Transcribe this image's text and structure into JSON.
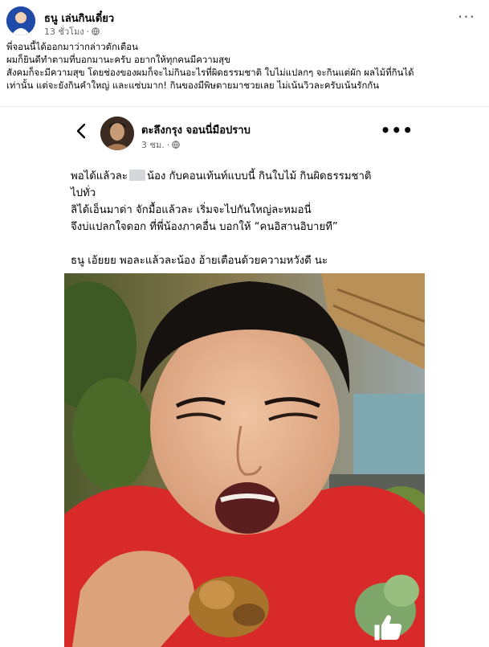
{
  "outer_post": {
    "author": "ธนู เล่นกินเดี๋ยว",
    "time": "13 ชั่วโมง",
    "more_icon": "more-options-icon",
    "caption_lines": [
      "พี่จอนนี้ได้ออกมาว่ากล่าวตักเตือน",
      "ผมก็ยินดีทำตามที่บอกมานะครับ อยากให้ทุกคนมีความสุข",
      "สังคมก็จะมีความสุข โดยช่องของผมก็จะไม่กินอะไรที่ผิดธรรมชาติ ใบไม่แปลกๆ จะกินแต่ผัก ผลไม้ที่กินได้",
      "เท่านั้น แต่จะยังกินคำใหญ่ และแซ่บมาก! กินของมีพิษตายมาชวยเลย ไม่เน้นวิวละครับเน้นรักกัน"
    ]
  },
  "shared_post": {
    "author": "ตะลึงกรุง จอนนี่มือปราบ",
    "time": "3 ชม.",
    "line1_pre": "พอได้แล้วละ",
    "line1_post": "น้อง กับคอนเท้นท์แบบนี้ กินใบไม้ กินผิดธรรมชาติ",
    "line2": "ไปทั่ว",
    "line3": "ลิได้เอ็นมาด่า จักมื้อแล้วละ เริ่มจะไปกันใหญ่ละหมอนี่",
    "line4": "จึงบ่แปลกใจดอก ที่พี่น้องภาคอื่น บอกให้ “คนอิสานอิบายที”",
    "line5": "ธนู เอ้ยยย พอละแล้วละน้อง อ้ายเตือนด้วยความหวังดี นะ"
  },
  "icons": {
    "back": "back-arrow-icon",
    "globe": "globe-icon",
    "like": "thumbs-up-icon"
  },
  "colors": {
    "meta_text": "#65676b",
    "shirt": "#d92a2a"
  }
}
